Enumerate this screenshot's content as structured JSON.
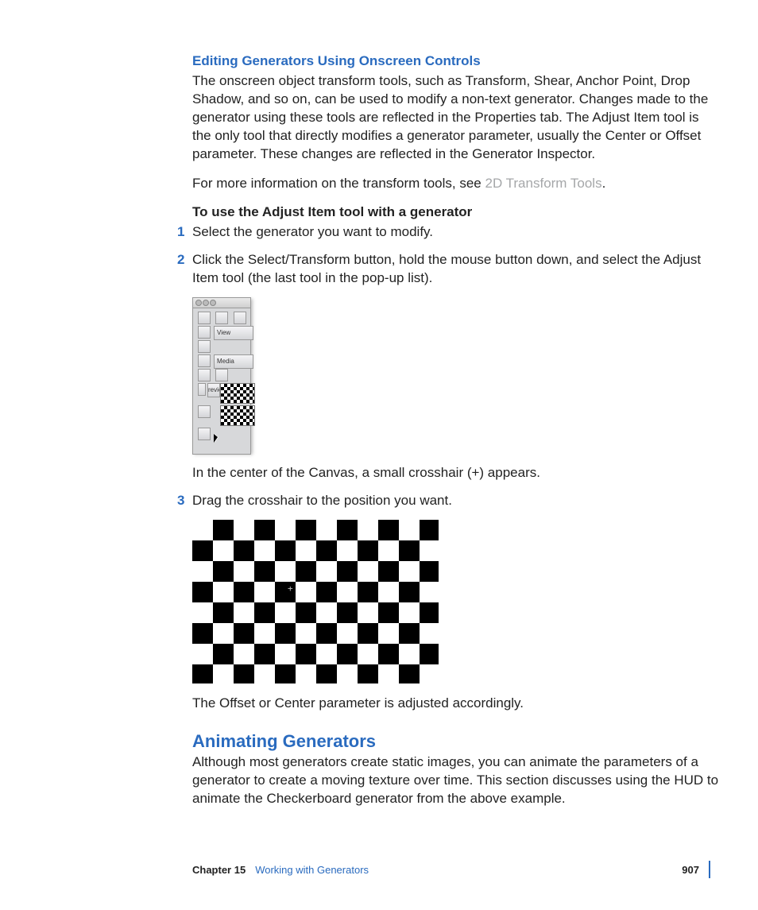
{
  "section1": {
    "heading": "Editing Generators Using Onscreen Controls",
    "para1": "The onscreen object transform tools, such as Transform, Shear, Anchor Point, Drop Shadow, and so on, can be used to modify a non-text generator. Changes made to the generator using these tools are reflected in the Properties tab. The Adjust Item tool is the only tool that directly modifies a generator parameter, usually the Center or Offset parameter. These changes are reflected in the Generator Inspector.",
    "para2a": "For more information on the transform tools, see ",
    "para2link": "2D Transform Tools",
    "para2b": ".",
    "taskHeading": "To use the Adjust Item tool with a generator",
    "step1": "Select the generator you want to modify.",
    "step2": "Click the Select/Transform button, hold the mouse button down, and select the Adjust Item tool (the last tool in the pop-up list).",
    "afterFig1": "In the center of the Canvas, a small crosshair (+) appears.",
    "step3": "Drag the crosshair to the position you want.",
    "afterFig2": "The Offset or Center parameter is adjusted accordingly."
  },
  "section2": {
    "heading": "Animating Generators",
    "para": "Although most generators create static images, you can animate the parameters of a generator to create a moving texture over time. This section discusses using the HUD to animate the Checkerboard generator from the above example."
  },
  "toolbar": {
    "viewLabel": "View",
    "mediaLabel": "Media",
    "reviewLabel": "review"
  },
  "footer": {
    "chapter": "Chapter 15",
    "title": "Working with Generators",
    "page": "907"
  }
}
